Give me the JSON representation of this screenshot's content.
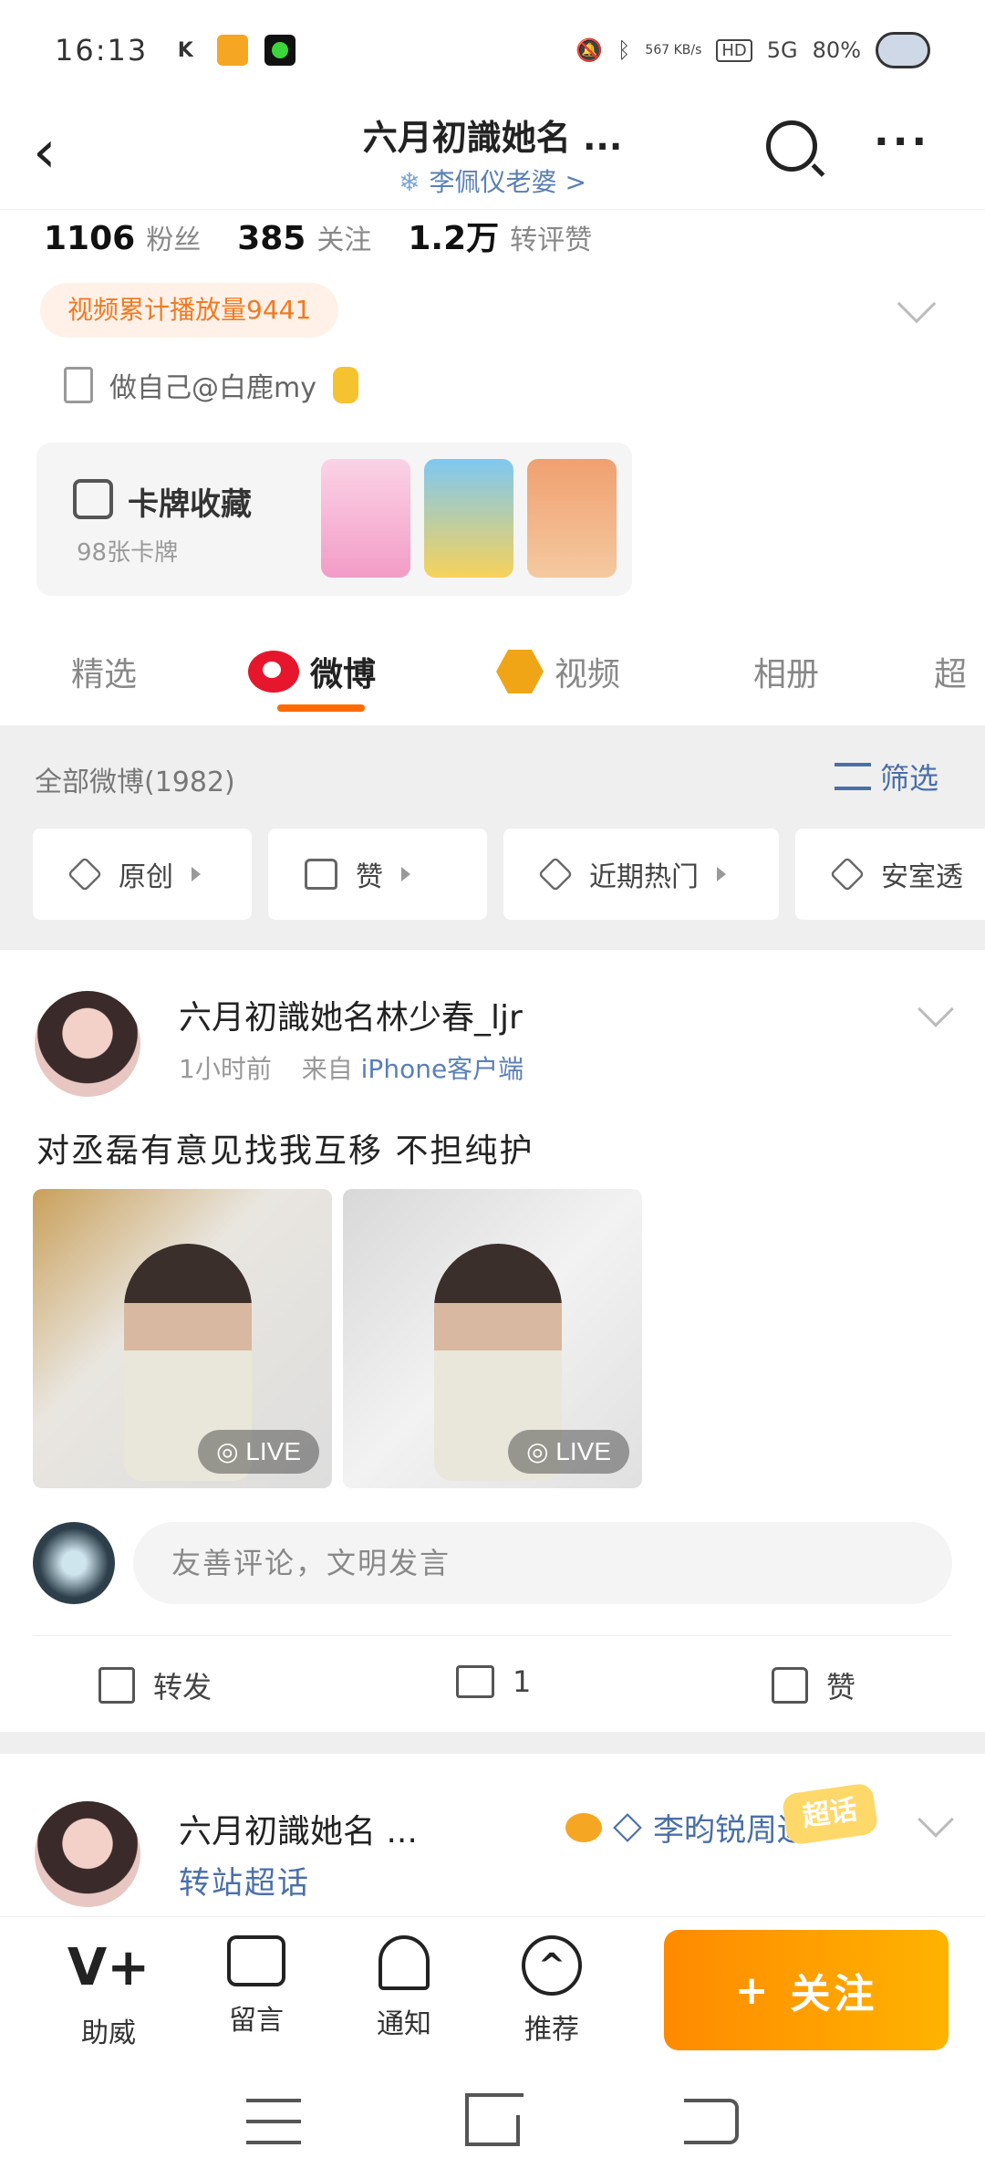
{
  "status_bar": {
    "time": "16:13",
    "net_speed": "567 KB/s",
    "signal": "5G",
    "battery": "80%"
  },
  "header": {
    "title": "六月初識她名 ...",
    "subtitle": "李佩仪老婆 >"
  },
  "profile": {
    "followers_count": "1106",
    "followers_label": "粉丝",
    "following_count": "385",
    "following_label": "关注",
    "interactions_count": "1.2万",
    "interactions_label": "转评赞",
    "play_badge": "视频累计播放量9441",
    "bio": "做自己@白鹿my",
    "card_title": "卡牌收藏",
    "card_sub": "98张卡牌"
  },
  "tabs": [
    {
      "label": "精选"
    },
    {
      "label": "微博"
    },
    {
      "label": "视频"
    },
    {
      "label": "相册"
    },
    {
      "label": "超"
    }
  ],
  "feed_header": {
    "all_count": "全部微博(1982)",
    "filter_label": "筛选"
  },
  "chips": [
    {
      "label": "原创"
    },
    {
      "label": "赞"
    },
    {
      "label": "近期热门"
    },
    {
      "label": "安室透"
    }
  ],
  "post1": {
    "author": "六月初識她名林少春_ljr",
    "time": "1小时前",
    "source_prefix": "来自",
    "source": "iPhone客户端",
    "text": "对丞磊有意见找我互移 不担纯护",
    "live_label": "LIVE",
    "comment_placeholder": "友善评论，文明发言",
    "share_label": "转发",
    "comment_count": "1",
    "like_label": "赞"
  },
  "post2": {
    "author": "六月初識她名 ...",
    "extra": "李昀锐周边",
    "tag": "超话",
    "repost_label": "转站超话"
  },
  "bottom_bar": {
    "items": [
      {
        "label": "助威",
        "icon": "V+"
      },
      {
        "label": "留言",
        "icon": ""
      },
      {
        "label": "通知",
        "icon": ""
      },
      {
        "label": "推荐",
        "icon": "^"
      }
    ],
    "follow_label": "关注",
    "follow_plus": "+"
  },
  "colors": {
    "accent": "#ff8a00",
    "link": "#4a6fa8",
    "weibo_red": "#e6162d"
  }
}
